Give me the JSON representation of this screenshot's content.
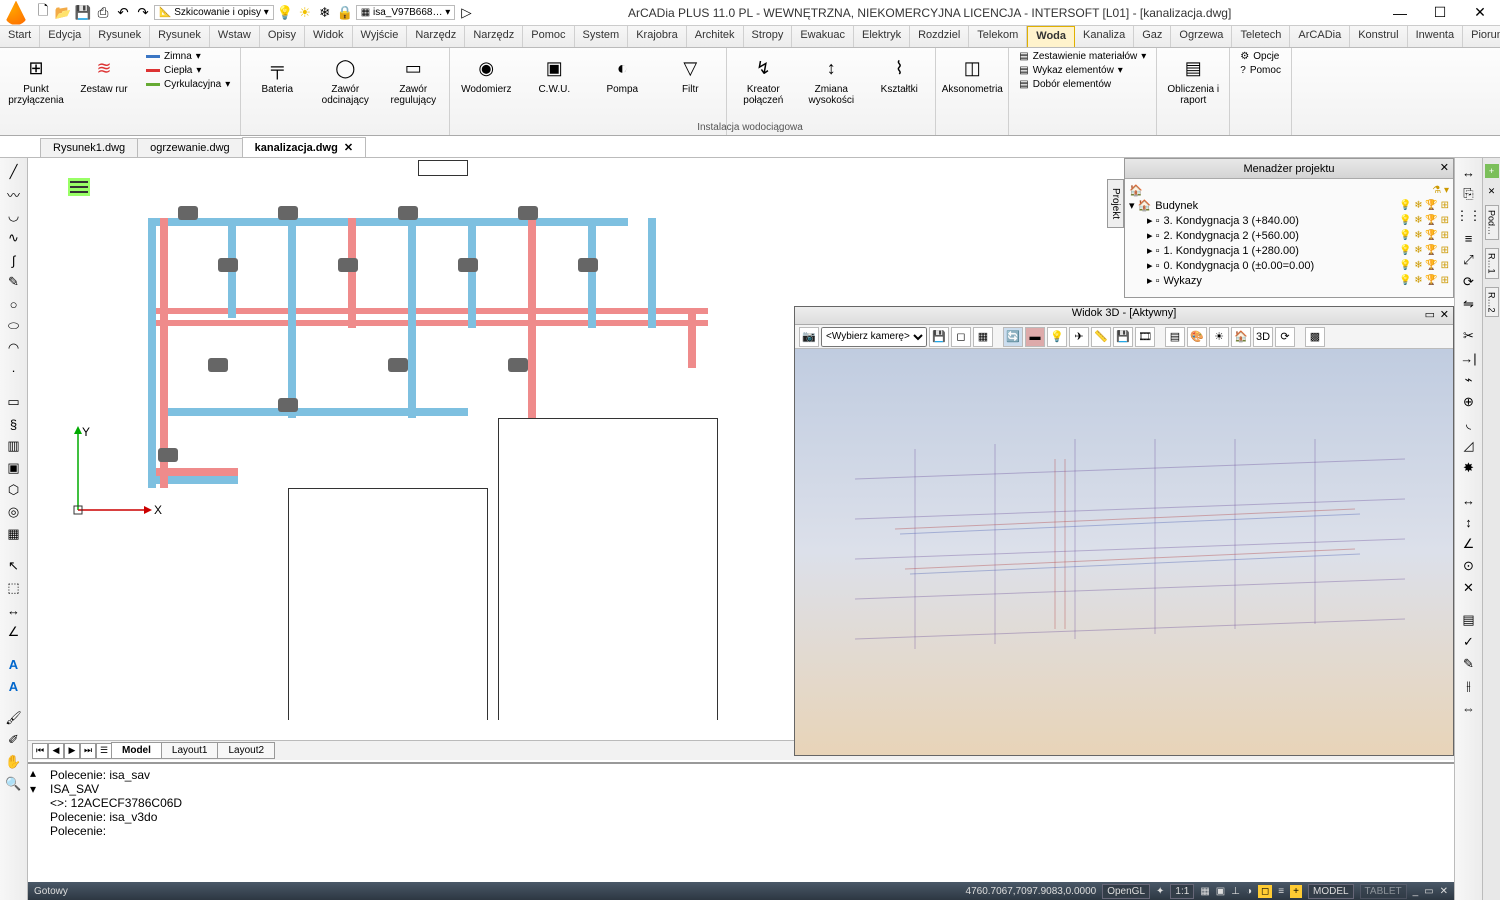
{
  "app": {
    "title": "ArCADia PLUS 11.0 PL - WEWNĘTRZNA, NIEKOMERCYJNA LICENCJA - INTERSOFT [L01] - [kanalizacja.dwg]"
  },
  "qat": {
    "mode_dropdown": "Szkicowanie i opisy",
    "doc_dropdown": "isa_V97B668…"
  },
  "ribbon_tabs": [
    "Start",
    "Edycja",
    "Rysunek",
    "Rysunek",
    "Wstaw",
    "Opisy",
    "Widok",
    "Wyjście",
    "Narzędz",
    "Narzędz",
    "Pomoc",
    "System",
    "Krajobra",
    "Architek",
    "Stropy",
    "Ewakuac",
    "Elektryk",
    "Rozdziel",
    "Telekom",
    "Woda",
    "Kanaliza",
    "Gaz",
    "Ogrzewa",
    "Teletech",
    "ArCADia",
    "Konstrul",
    "Inwenta",
    "Pioruno"
  ],
  "ribbon_active": "Woda",
  "ribbon": {
    "group1": {
      "label": "",
      "big": [
        {
          "label": "Punkt\nprzyłączenia",
          "icon": "⊞"
        },
        {
          "label": "Zestaw\nrur",
          "icon": "≋"
        }
      ],
      "small": [
        "Zimna",
        "Ciepła",
        "Cyrkulacyjna"
      ],
      "small_colors": [
        "#3b76c4",
        "#d33",
        "#6a3"
      ]
    },
    "group2": {
      "label": "",
      "big": [
        {
          "label": "Bateria",
          "icon": "╤"
        },
        {
          "label": "Zawór\nodcinający",
          "icon": "◯"
        },
        {
          "label": "Zawór\nregulujący",
          "icon": "▭"
        }
      ]
    },
    "group3": {
      "label": "",
      "big": [
        {
          "label": "Wodomierz",
          "icon": "◉"
        },
        {
          "label": "C.W.U.",
          "icon": "▣"
        },
        {
          "label": "Pompa",
          "icon": "◐"
        },
        {
          "label": "Filtr",
          "icon": "▽"
        }
      ]
    },
    "group4": {
      "label": "",
      "big": [
        {
          "label": "Kreator\npołączeń",
          "icon": "↯"
        },
        {
          "label": "Zmiana\nwysokości",
          "icon": "↕"
        },
        {
          "label": "Kształtki",
          "icon": "⌇"
        }
      ]
    },
    "group5": {
      "label": "",
      "big": [
        {
          "label": "Aksonometria",
          "icon": "◫"
        }
      ]
    },
    "group6": {
      "small": [
        "Zestawienie materiałów",
        "Wykaz elementów",
        "Dobór elementów"
      ]
    },
    "group7": {
      "label": "",
      "big": [
        {
          "label": "Obliczenia\ni raport",
          "icon": "▤"
        }
      ]
    },
    "group8": {
      "small": [
        "Opcje",
        "Pomoc"
      ]
    },
    "footer": "Instalacja wodociągowa"
  },
  "doc_tabs": [
    "Rysunek1.dwg",
    "ogrzewanie.dwg",
    "kanalizacja.dwg"
  ],
  "doc_active": "kanalizacja.dwg",
  "layout": {
    "tabs": [
      "Model",
      "Layout1",
      "Layout2"
    ],
    "active": "Model"
  },
  "cmd_lines": [
    "Polecenie: isa_sav",
    "ISA_SAV",
    "<>: 12ACECF3786C06D",
    "Polecenie: isa_v3do",
    "Polecenie:"
  ],
  "status": {
    "left": "Gotowy",
    "coords": "4760.7067,7097.9083,0.0000",
    "gl": "OpenGL",
    "scale": "1:1",
    "mode": "MODEL",
    "tablet": "TABLET"
  },
  "pm": {
    "title": "Menadżer projektu",
    "root": "Budynek",
    "items": [
      "3. Kondygnacja 3 (+840.00)",
      "2. Kondygnacja 2 (+560.00)",
      "1. Kondygnacja 1 (+280.00)",
      "0. Kondygnacja 0 (±0.00=0.00)",
      "Wykazy"
    ],
    "side_tab": "Projekt"
  },
  "view3d": {
    "title": "Widok 3D - [Aktywny]",
    "camera_placeholder": "<Wybierz kamerę>"
  },
  "right_rail": [
    "Pod…",
    "R…1",
    "R…2"
  ],
  "axes": {
    "x": "X",
    "y": "Y"
  }
}
